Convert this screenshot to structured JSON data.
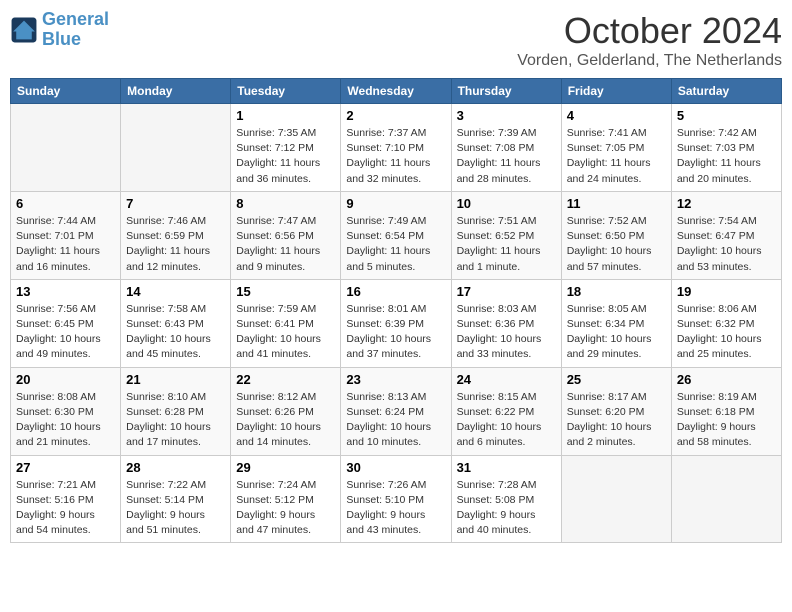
{
  "header": {
    "logo_line1": "General",
    "logo_line2": "Blue",
    "month": "October 2024",
    "location": "Vorden, Gelderland, The Netherlands"
  },
  "weekdays": [
    "Sunday",
    "Monday",
    "Tuesday",
    "Wednesday",
    "Thursday",
    "Friday",
    "Saturday"
  ],
  "weeks": [
    [
      {
        "day": "",
        "empty": true
      },
      {
        "day": "",
        "empty": true
      },
      {
        "day": "1",
        "sunrise": "7:35 AM",
        "sunset": "7:12 PM",
        "daylight": "11 hours and 36 minutes."
      },
      {
        "day": "2",
        "sunrise": "7:37 AM",
        "sunset": "7:10 PM",
        "daylight": "11 hours and 32 minutes."
      },
      {
        "day": "3",
        "sunrise": "7:39 AM",
        "sunset": "7:08 PM",
        "daylight": "11 hours and 28 minutes."
      },
      {
        "day": "4",
        "sunrise": "7:41 AM",
        "sunset": "7:05 PM",
        "daylight": "11 hours and 24 minutes."
      },
      {
        "day": "5",
        "sunrise": "7:42 AM",
        "sunset": "7:03 PM",
        "daylight": "11 hours and 20 minutes."
      }
    ],
    [
      {
        "day": "6",
        "sunrise": "7:44 AM",
        "sunset": "7:01 PM",
        "daylight": "11 hours and 16 minutes."
      },
      {
        "day": "7",
        "sunrise": "7:46 AM",
        "sunset": "6:59 PM",
        "daylight": "11 hours and 12 minutes."
      },
      {
        "day": "8",
        "sunrise": "7:47 AM",
        "sunset": "6:56 PM",
        "daylight": "11 hours and 9 minutes."
      },
      {
        "day": "9",
        "sunrise": "7:49 AM",
        "sunset": "6:54 PM",
        "daylight": "11 hours and 5 minutes."
      },
      {
        "day": "10",
        "sunrise": "7:51 AM",
        "sunset": "6:52 PM",
        "daylight": "11 hours and 1 minute."
      },
      {
        "day": "11",
        "sunrise": "7:52 AM",
        "sunset": "6:50 PM",
        "daylight": "10 hours and 57 minutes."
      },
      {
        "day": "12",
        "sunrise": "7:54 AM",
        "sunset": "6:47 PM",
        "daylight": "10 hours and 53 minutes."
      }
    ],
    [
      {
        "day": "13",
        "sunrise": "7:56 AM",
        "sunset": "6:45 PM",
        "daylight": "10 hours and 49 minutes."
      },
      {
        "day": "14",
        "sunrise": "7:58 AM",
        "sunset": "6:43 PM",
        "daylight": "10 hours and 45 minutes."
      },
      {
        "day": "15",
        "sunrise": "7:59 AM",
        "sunset": "6:41 PM",
        "daylight": "10 hours and 41 minutes."
      },
      {
        "day": "16",
        "sunrise": "8:01 AM",
        "sunset": "6:39 PM",
        "daylight": "10 hours and 37 minutes."
      },
      {
        "day": "17",
        "sunrise": "8:03 AM",
        "sunset": "6:36 PM",
        "daylight": "10 hours and 33 minutes."
      },
      {
        "day": "18",
        "sunrise": "8:05 AM",
        "sunset": "6:34 PM",
        "daylight": "10 hours and 29 minutes."
      },
      {
        "day": "19",
        "sunrise": "8:06 AM",
        "sunset": "6:32 PM",
        "daylight": "10 hours and 25 minutes."
      }
    ],
    [
      {
        "day": "20",
        "sunrise": "8:08 AM",
        "sunset": "6:30 PM",
        "daylight": "10 hours and 21 minutes."
      },
      {
        "day": "21",
        "sunrise": "8:10 AM",
        "sunset": "6:28 PM",
        "daylight": "10 hours and 17 minutes."
      },
      {
        "day": "22",
        "sunrise": "8:12 AM",
        "sunset": "6:26 PM",
        "daylight": "10 hours and 14 minutes."
      },
      {
        "day": "23",
        "sunrise": "8:13 AM",
        "sunset": "6:24 PM",
        "daylight": "10 hours and 10 minutes."
      },
      {
        "day": "24",
        "sunrise": "8:15 AM",
        "sunset": "6:22 PM",
        "daylight": "10 hours and 6 minutes."
      },
      {
        "day": "25",
        "sunrise": "8:17 AM",
        "sunset": "6:20 PM",
        "daylight": "10 hours and 2 minutes."
      },
      {
        "day": "26",
        "sunrise": "8:19 AM",
        "sunset": "6:18 PM",
        "daylight": "9 hours and 58 minutes."
      }
    ],
    [
      {
        "day": "27",
        "sunrise": "7:21 AM",
        "sunset": "5:16 PM",
        "daylight": "9 hours and 54 minutes."
      },
      {
        "day": "28",
        "sunrise": "7:22 AM",
        "sunset": "5:14 PM",
        "daylight": "9 hours and 51 minutes."
      },
      {
        "day": "29",
        "sunrise": "7:24 AM",
        "sunset": "5:12 PM",
        "daylight": "9 hours and 47 minutes."
      },
      {
        "day": "30",
        "sunrise": "7:26 AM",
        "sunset": "5:10 PM",
        "daylight": "9 hours and 43 minutes."
      },
      {
        "day": "31",
        "sunrise": "7:28 AM",
        "sunset": "5:08 PM",
        "daylight": "9 hours and 40 minutes."
      },
      {
        "day": "",
        "empty": true
      },
      {
        "day": "",
        "empty": true
      }
    ]
  ]
}
